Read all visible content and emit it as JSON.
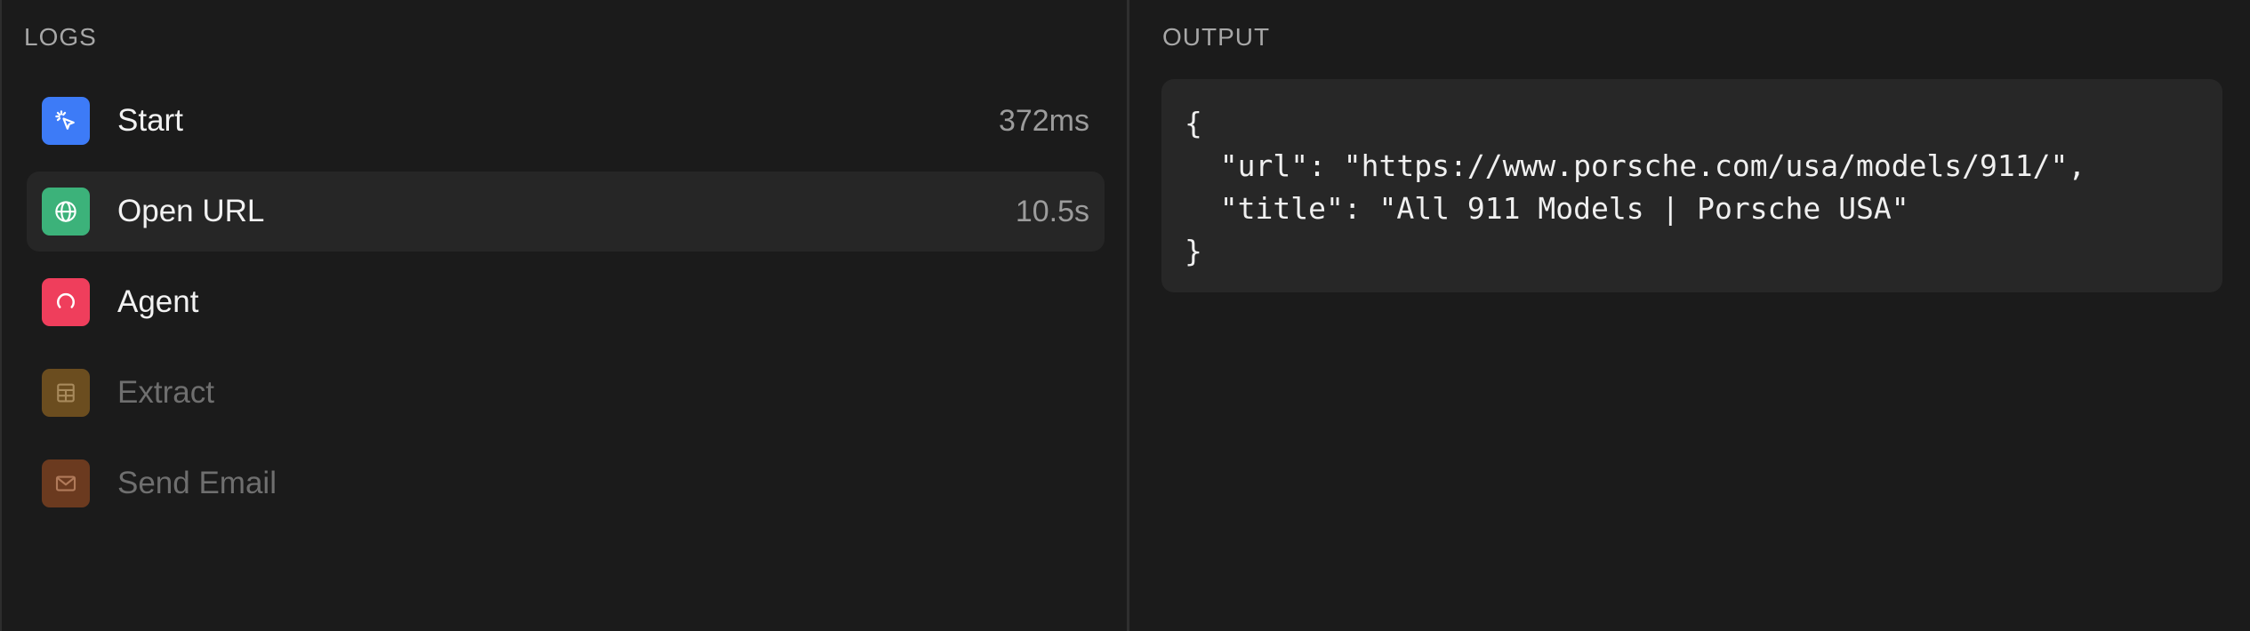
{
  "logs_panel": {
    "title": "LOGS",
    "items": [
      {
        "label": "Start",
        "time": "372ms",
        "icon": "cursor-click-icon",
        "color": "#3d7bf7",
        "state": "done"
      },
      {
        "label": "Open URL",
        "time": "10.5s",
        "icon": "globe-icon",
        "color": "#3cb27a",
        "state": "active"
      },
      {
        "label": "Agent",
        "time": "",
        "icon": "spinner-icon",
        "color": "#ef3e5c",
        "state": "running"
      },
      {
        "label": "Extract",
        "time": "",
        "icon": "table-icon",
        "color": "#6b4d1f",
        "state": "pending"
      },
      {
        "label": "Send Email",
        "time": "",
        "icon": "mail-icon",
        "color": "#6b3a1f",
        "state": "pending"
      }
    ]
  },
  "output_panel": {
    "title": "OUTPUT",
    "json_text": "{\n  \"url\": \"https://www.porsche.com/usa/models/911/\",\n  \"title\": \"All 911 Models | Porsche USA\"\n}"
  }
}
